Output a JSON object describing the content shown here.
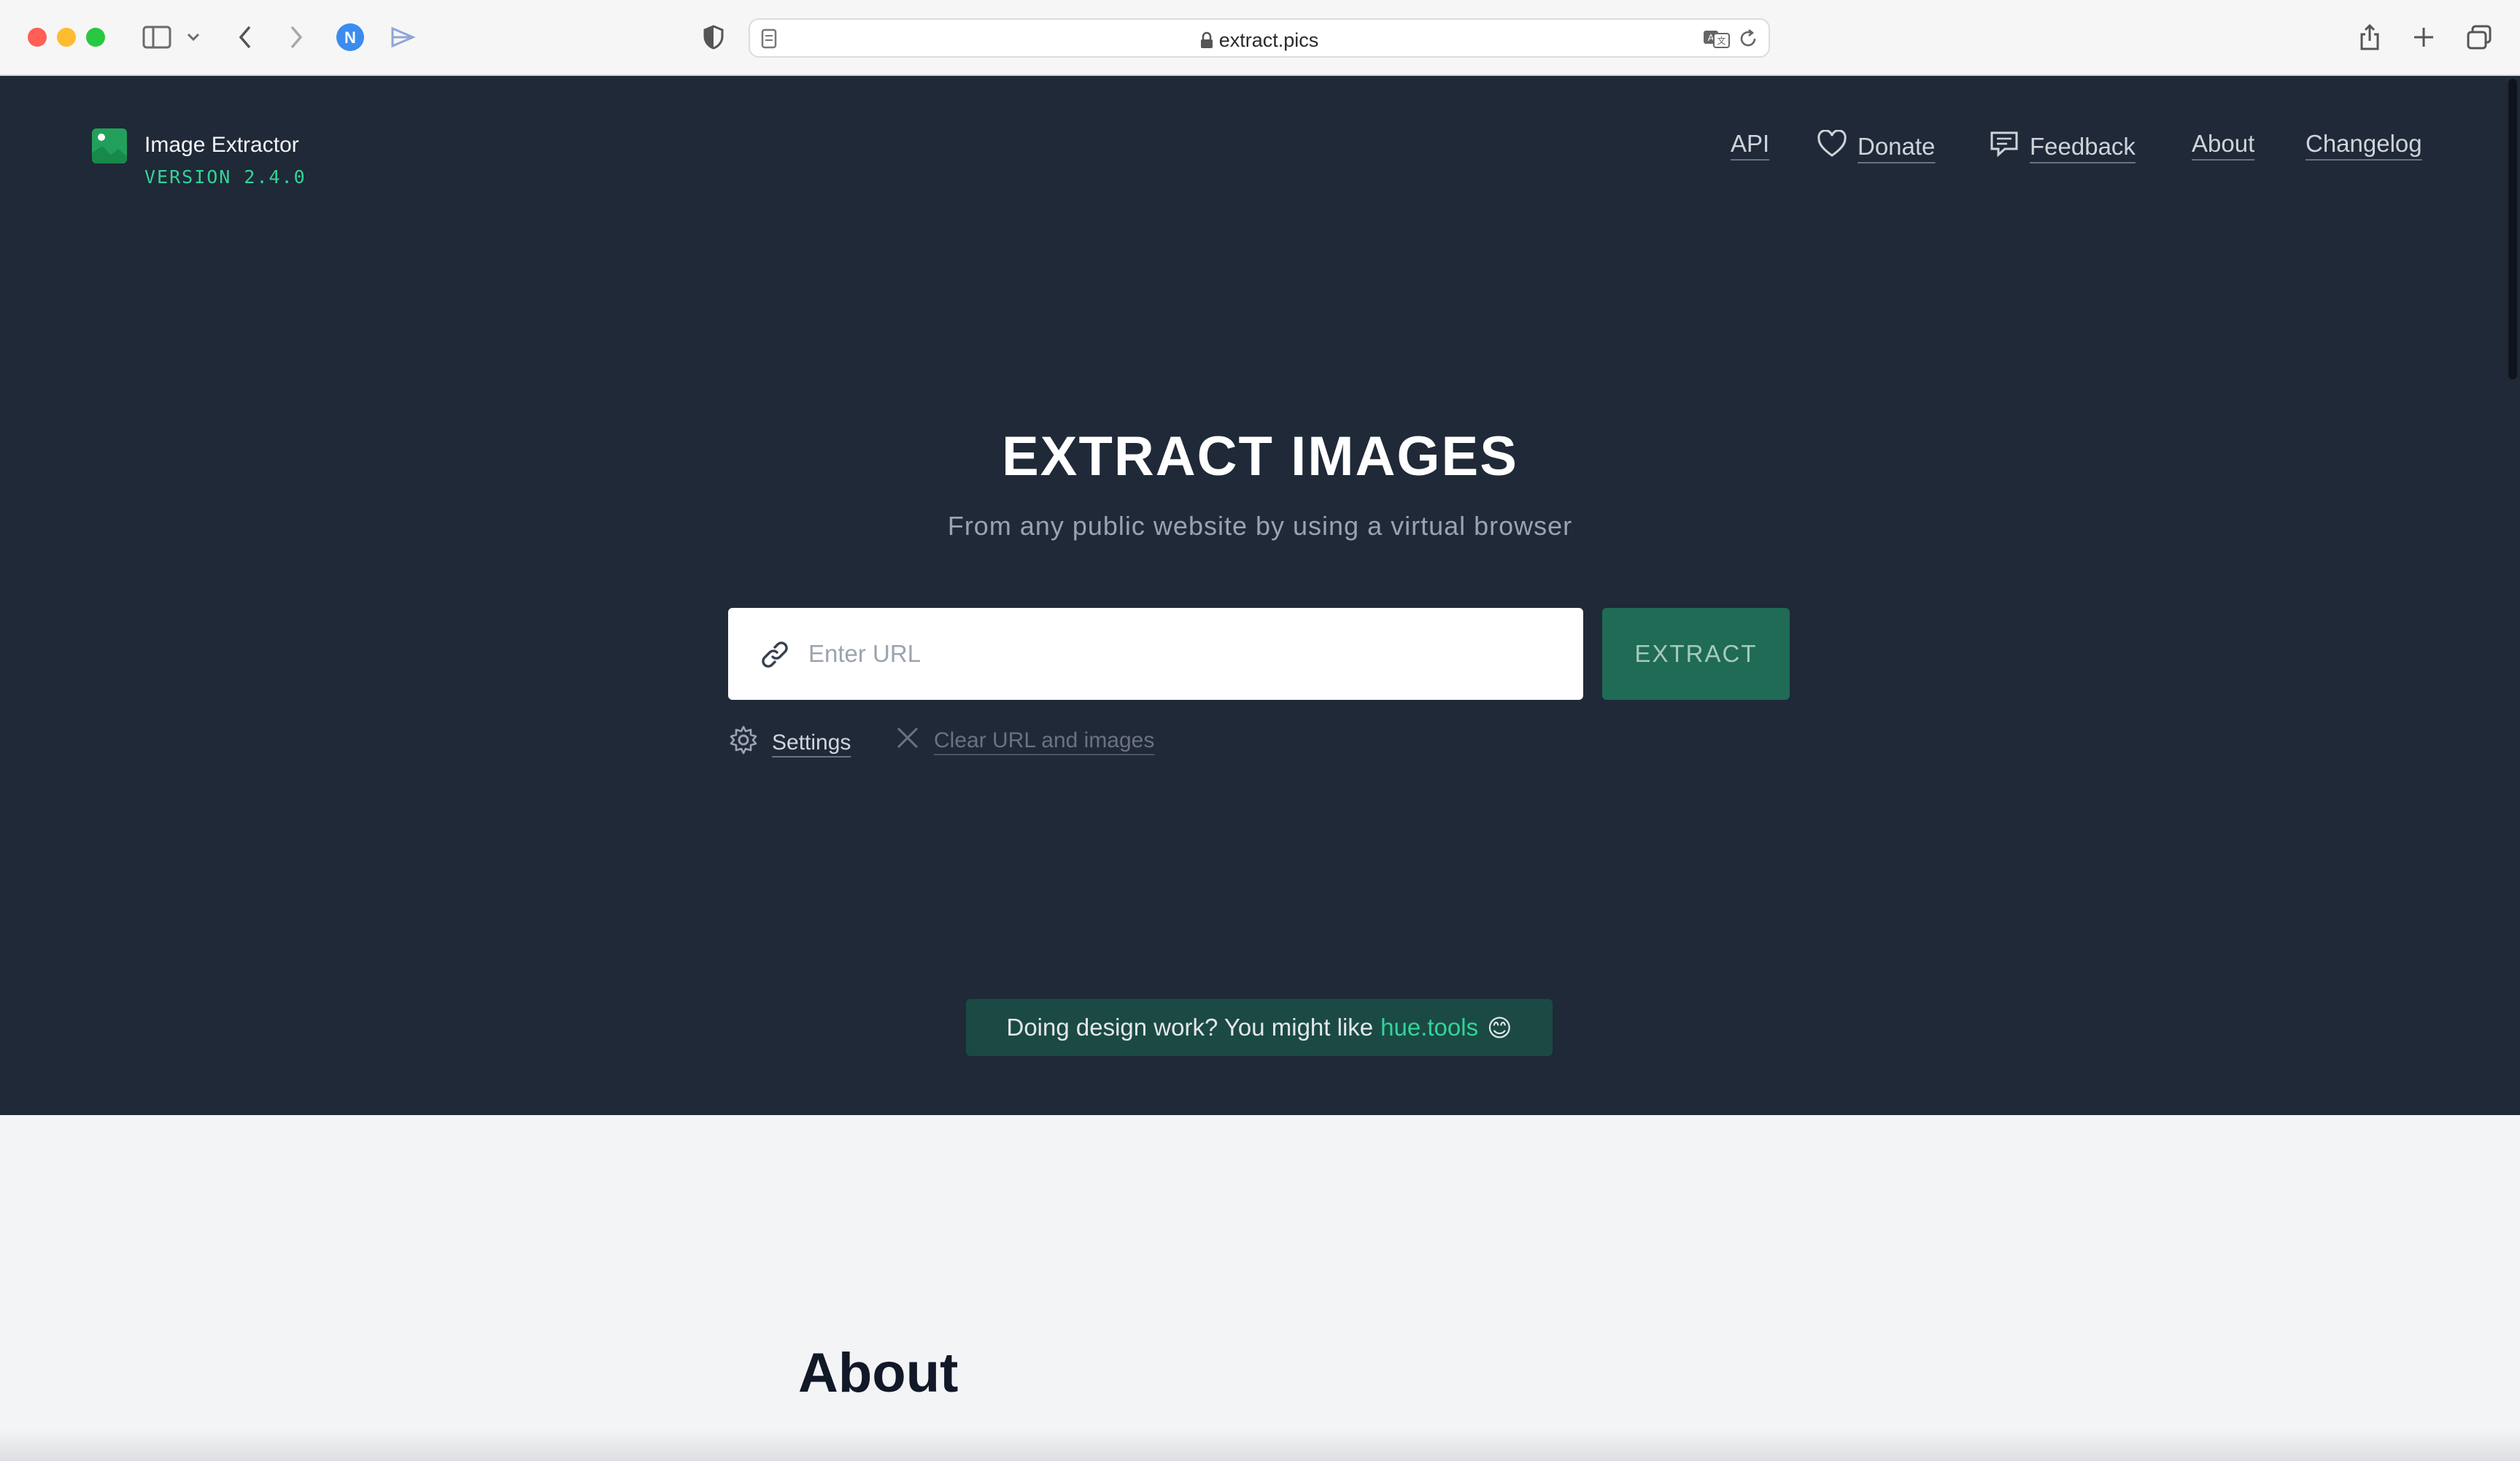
{
  "browser": {
    "url": "extract.pics",
    "traffic_colors": [
      "#ff5f57",
      "#febc2e",
      "#28c840"
    ]
  },
  "header": {
    "app_name": "Image Extractor",
    "version": "VERSION 2.4.0",
    "logo_icon": "image-icon",
    "nav": {
      "api": "API",
      "donate": "Donate",
      "feedback": "Feedback",
      "about": "About",
      "changelog": "Changelog"
    }
  },
  "hero": {
    "title": "EXTRACT IMAGES",
    "subtitle": "From any public website by using a virtual browser",
    "url_placeholder": "Enter URL",
    "url_value": "",
    "extract_label": "EXTRACT",
    "settings_label": "Settings",
    "clear_label": "Clear URL and images"
  },
  "promo": {
    "text": "Doing design work? You might like",
    "link_text": "hue.tools",
    "emoji": "😊"
  },
  "about_section": {
    "heading": "About"
  },
  "colors": {
    "hero_bg": "#1f2937",
    "accent": "#34d399",
    "button_bg": "#1f6b55",
    "page_bg": "#f3f4f6"
  }
}
